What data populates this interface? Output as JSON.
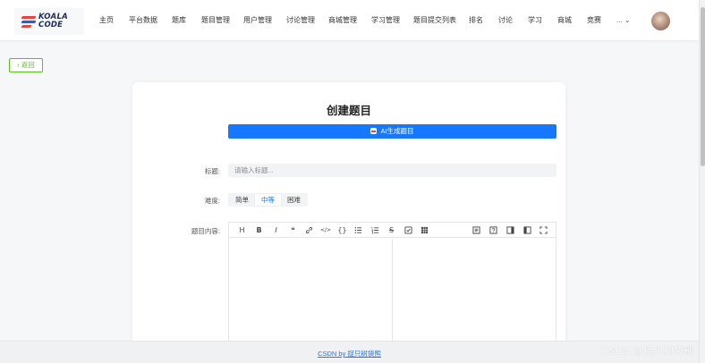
{
  "logo": {
    "line1": "KOALA",
    "line2": "CODE"
  },
  "nav": {
    "items": [
      "主页",
      "平台数据",
      "题库",
      "题目管理",
      "用户管理",
      "讨论管理",
      "商城管理",
      "学习管理",
      "题目提交列表",
      "排名",
      "讨论",
      "学习",
      "商城",
      "竞赛"
    ],
    "more_label": "... ⌄"
  },
  "back_label": "‹ 返回",
  "page_title": "创建题目",
  "ai_button_label": "AI生成题目",
  "form": {
    "title_label": "标题:",
    "title_placeholder": "请输入标题...",
    "difficulty_label": "难度:",
    "difficulty_options": [
      "简单",
      "中等",
      "困难"
    ],
    "difficulty_selected": "中等",
    "content_label": "题目内容:"
  },
  "editor": {
    "toolbar_left": [
      {
        "glyph": "H",
        "icon": "heading-icon"
      },
      {
        "glyph": "B",
        "icon": "bold-icon"
      },
      {
        "glyph": "I",
        "icon": "italic-icon"
      },
      {
        "glyph": "❝",
        "icon": "quote-icon"
      },
      {
        "glyph": "",
        "icon": "link-icon"
      },
      {
        "glyph": "</>",
        "icon": "code-icon"
      },
      {
        "glyph": "{}",
        "icon": "code-block-icon"
      },
      {
        "glyph": "",
        "icon": "unordered-list-icon"
      },
      {
        "glyph": "",
        "icon": "ordered-list-icon"
      },
      {
        "glyph": "S",
        "icon": "strikethrough-icon"
      },
      {
        "glyph": "",
        "icon": "task-list-icon"
      },
      {
        "glyph": "",
        "icon": "table-icon"
      }
    ],
    "toolbar_right": [
      "preview-icon",
      "help-icon",
      "sidebar-icon",
      "split-view-icon",
      "fullscreen-icon"
    ]
  },
  "footer_link": "CSDN by 捉只树袋熊",
  "watermark": "CSDN @捉只树袋熊",
  "colors": {
    "primary": "#1677ff",
    "back_green": "#52c41a"
  }
}
